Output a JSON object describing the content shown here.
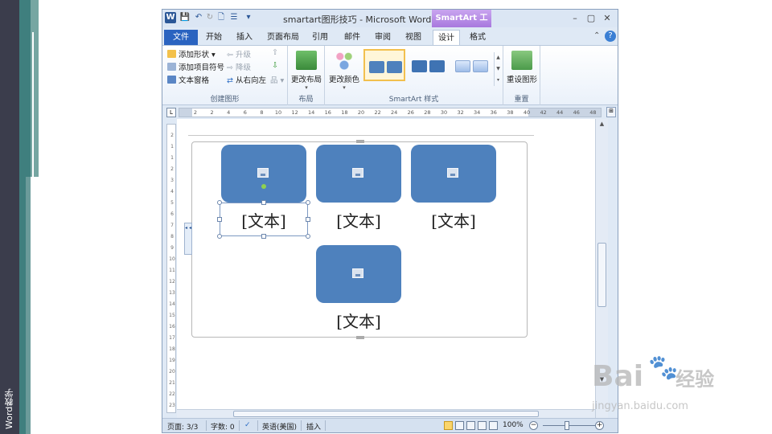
{
  "slide": {
    "side_caption": "Word教学"
  },
  "window": {
    "title": "smartart图形技巧 - Microsoft Word",
    "context_tab": "SmartArt 工具",
    "qa": {
      "logo": "W",
      "save": "💾",
      "undo": "↶",
      "redo": "↻",
      "new": "🗋",
      "format": "☰",
      "more": "▾"
    },
    "controls": {
      "minimize": "–",
      "restore": "▢",
      "close": "✕"
    }
  },
  "tabs": {
    "file": "文件",
    "items": [
      "开始",
      "插入",
      "页面布局",
      "引用",
      "邮件",
      "审阅",
      "视图",
      "设计",
      "格式"
    ],
    "collapse": "⌃",
    "help": "?"
  },
  "ribbon": {
    "create_group": {
      "label": "创建图形",
      "add_shape": "添加形状 ▾",
      "add_bullet": "添加项目符号",
      "text_pane": "文本窗格",
      "promote": "升级",
      "demote": "降级",
      "right_to_left": "从右向左",
      "move_up": "⇧",
      "move_down": "⇩",
      "layout_small": "品 ▾"
    },
    "layout_group": {
      "label": "布局",
      "change_layout": "更改布局",
      "arrow": "▾"
    },
    "styles_group": {
      "label": "SmartArt 样式",
      "change_colors": "更改颜色",
      "arrow": "▾",
      "scroll": "▲ ▼ ▾"
    },
    "reset_group": {
      "label": "重置",
      "reset_graphic": "重设图形"
    }
  },
  "ruler": {
    "corner": "L",
    "toggle": "⊞",
    "ticks": [
      "2",
      "2",
      "4",
      "6",
      "8",
      "10",
      "12",
      "14",
      "16",
      "18",
      "20",
      "22",
      "24",
      "26",
      "28",
      "30",
      "32",
      "34",
      "36",
      "38",
      "40",
      "42",
      "44",
      "46",
      "48"
    ],
    "vticks": [
      "2",
      "1",
      "1",
      "2",
      "3",
      "4",
      "5",
      "6",
      "7",
      "8",
      "9",
      "10",
      "11",
      "12",
      "13",
      "14",
      "15",
      "16",
      "17",
      "18",
      "19",
      "20",
      "21",
      "22",
      "23"
    ]
  },
  "smartart": {
    "text_pane_arrows": "◂\n◂",
    "boxes": [
      {
        "label": "[文本]"
      },
      {
        "label": "[文本]"
      },
      {
        "label": "[文本]"
      },
      {
        "label": "[文本]"
      }
    ],
    "box_color": "#4e81bd"
  },
  "scroll": {
    "up": "▲",
    "down": "▼"
  },
  "status": {
    "page": "页面: 3/3",
    "words": "字数: 0",
    "proof_icon": "✓",
    "language": "英语(美国)",
    "mode": "插入",
    "zoom": "100%",
    "zoom_out": "−",
    "zoom_in": "+"
  },
  "watermark": {
    "main": "Bai",
    "main2": "经验",
    "paw": "🐾",
    "url": "jingyan.baidu.com"
  }
}
